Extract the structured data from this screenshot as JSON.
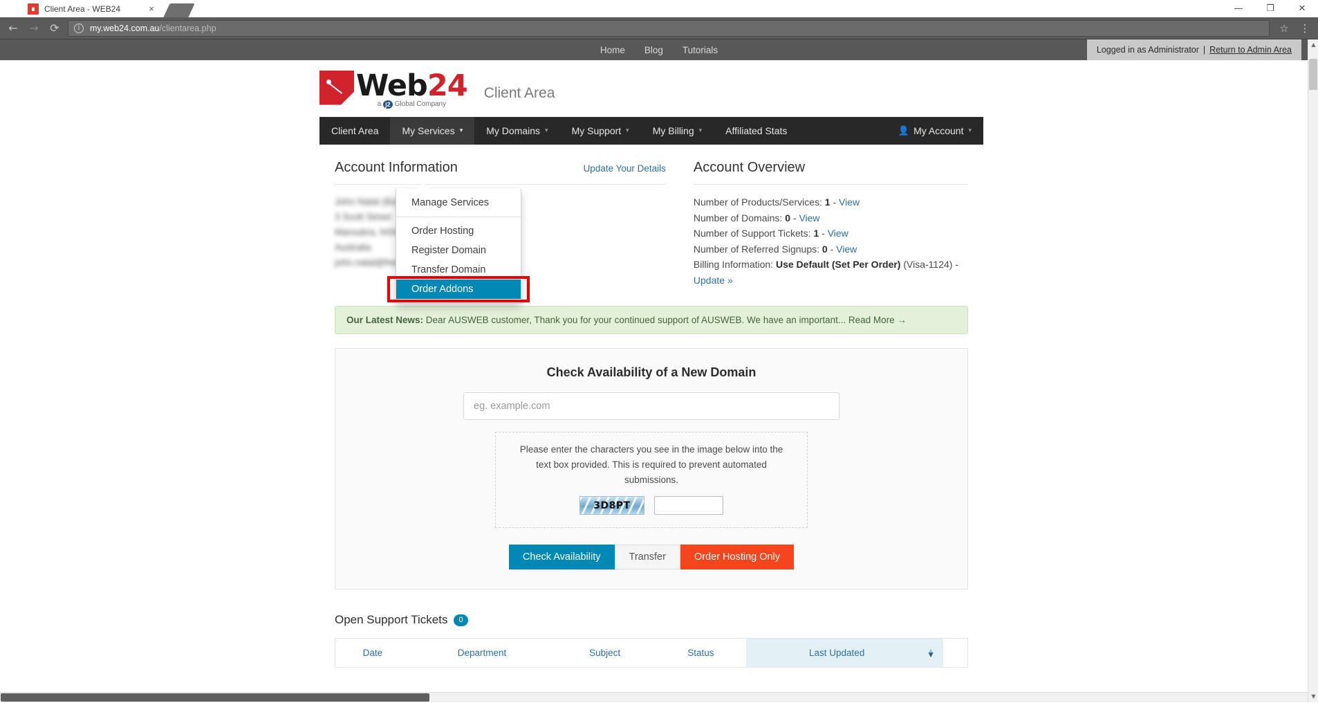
{
  "browser": {
    "tab": {
      "title": "Client Area - WEB24",
      "favicon": "web24-favicon",
      "close_label": "×"
    },
    "new_tab_label": "",
    "window_controls": {
      "minimize": "—",
      "maximize": "❐",
      "close": "✕"
    },
    "nav": {
      "back": "←",
      "forward": "→",
      "reload": "⟳"
    },
    "url": {
      "info_glyph": "i",
      "host": "my.web24.com.au",
      "path": "/clientarea.php"
    },
    "bookmark_glyph": "☆",
    "menu_glyph": "⋮"
  },
  "topbar": {
    "links": [
      "Home",
      "Blog",
      "Tutorials"
    ],
    "admin_text": "Logged in as Administrator",
    "admin_separator": "|",
    "admin_link": "Return to Admin Area"
  },
  "header": {
    "logo_web": "Web",
    "logo_num": "24",
    "logo_sub_a": "a",
    "logo_sub_j2": "j2",
    "logo_sub_b": "Global Company",
    "page_title": "Client Area"
  },
  "mainnav": {
    "items": [
      {
        "label": "Client Area",
        "caret": false,
        "active": false
      },
      {
        "label": "My Services",
        "caret": true,
        "active": true
      },
      {
        "label": "My Domains",
        "caret": true,
        "active": false
      },
      {
        "label": "My Support",
        "caret": true,
        "active": false
      },
      {
        "label": "My Billing",
        "caret": true,
        "active": false
      },
      {
        "label": "Affiliated Stats",
        "caret": false,
        "active": false
      }
    ],
    "account": {
      "label": "My Account",
      "icon": "person-icon",
      "caret": "▾"
    },
    "caret_glyph": "▾"
  },
  "dropdown": {
    "items": [
      "Manage Services",
      "Order Hosting",
      "Register Domain",
      "Transfer Domain"
    ],
    "selected_item": "Order Addons"
  },
  "account_info": {
    "title": "Account Information",
    "update_link": "Update Your Details",
    "lines": [
      "John Natal (Business)",
      "3 Scott Street",
      "Maroubra, NSW 2035",
      "Australia",
      "john.natal@freehills.com"
    ]
  },
  "account_overview": {
    "title": "Account Overview",
    "rows": [
      {
        "label": "Number of Products/Services:",
        "value": "1",
        "sep": "-",
        "link": "View"
      },
      {
        "label": "Number of Domains:",
        "value": "0",
        "sep": "-",
        "link": "View"
      },
      {
        "label": "Number of Support Tickets:",
        "value": "1",
        "sep": "-",
        "link": "View"
      },
      {
        "label": "Number of Referred Signups:",
        "value": "0",
        "sep": "-",
        "link": "View"
      }
    ],
    "billing": {
      "label": "Billing Information:",
      "value": "Use Default (Set Per Order)",
      "card": "(Visa-1124)",
      "sep": "-",
      "link": "Update »"
    }
  },
  "news": {
    "prefix": "Our Latest News:",
    "body": "Dear AUSWEB customer, Thank you for your continued support of AUSWEB. We have an important...",
    "link": "Read More →"
  },
  "domain_check": {
    "title": "Check Availability of a New Domain",
    "input_value": "",
    "input_placeholder": "eg. example.com",
    "captcha_text": "Please enter the characters you see in the image below into the text box provided. This is required to prevent automated submissions.",
    "captcha_code": "3D8PT",
    "captcha_input_value": "",
    "buttons": {
      "check": "Check Availability",
      "transfer": "Transfer",
      "hosting": "Order Hosting Only"
    }
  },
  "tickets": {
    "title": "Open Support Tickets",
    "count": "0",
    "columns": [
      "Date",
      "Department",
      "Subject",
      "Status",
      "Last Updated"
    ],
    "sorted_column": "Last Updated",
    "sort_up": "▲",
    "sort_down": "▼"
  },
  "colors": {
    "brand_red": "#d0232b",
    "accent_blue": "#0288b5",
    "danger": "#f4451d",
    "nav_dark": "#282828",
    "highlight_red": "#ee0000",
    "news_green_bg": "#e3f0da"
  }
}
